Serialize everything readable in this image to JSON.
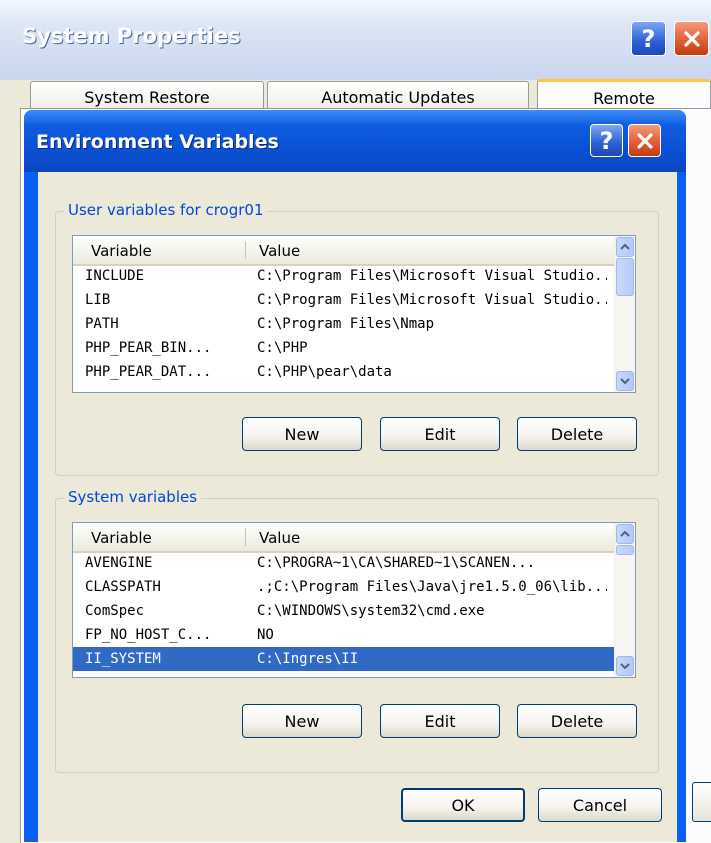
{
  "system_properties": {
    "title": "System Properties",
    "tabs": [
      {
        "label": "System Restore"
      },
      {
        "label": "Automatic Updates"
      },
      {
        "label": "Remote"
      }
    ]
  },
  "env_dialog": {
    "title": "Environment Variables",
    "user_group": {
      "label": "User variables for crogr01",
      "columns": {
        "variable": "Variable",
        "value": "Value"
      },
      "rows": [
        {
          "variable": "INCLUDE",
          "value": "C:\\Program Files\\Microsoft Visual Studio..."
        },
        {
          "variable": "LIB",
          "value": "C:\\Program Files\\Microsoft Visual Studio..."
        },
        {
          "variable": "PATH",
          "value": "C:\\Program Files\\Nmap"
        },
        {
          "variable": "PHP_PEAR_BIN...",
          "value": "C:\\PHP"
        },
        {
          "variable": "PHP_PEAR_DAT...",
          "value": "C:\\PHP\\pear\\data"
        }
      ],
      "buttons": {
        "new": "New",
        "edit": "Edit",
        "delete": "Delete"
      }
    },
    "system_group": {
      "label": "System variables",
      "columns": {
        "variable": "Variable",
        "value": "Value"
      },
      "rows": [
        {
          "variable": "AVENGINE",
          "value": "C:\\PROGRA~1\\CA\\SHARED~1\\SCANEN..."
        },
        {
          "variable": "CLASSPATH",
          "value": ".;C:\\Program Files\\Java\\jre1.5.0_06\\lib..."
        },
        {
          "variable": "ComSpec",
          "value": "C:\\WINDOWS\\system32\\cmd.exe"
        },
        {
          "variable": "FP_NO_HOST_C...",
          "value": "NO"
        },
        {
          "variable": "II_SYSTEM",
          "value": "C:\\Ingres\\II",
          "selected": true
        }
      ],
      "buttons": {
        "new": "New",
        "edit": "Edit",
        "delete": "Delete"
      }
    },
    "footer": {
      "ok": "OK",
      "cancel": "Cancel"
    }
  },
  "icons": {
    "help": "help-question-icon",
    "close": "close-x-icon",
    "scroll_up": "chevron-up-icon",
    "scroll_down": "chevron-down-icon"
  },
  "colors": {
    "title_blue": "#0a4fd0",
    "dialog_bg": "#ece9d8",
    "selection": "#316ac5",
    "group_label": "#0046d5",
    "close_red": "#e05a32"
  }
}
